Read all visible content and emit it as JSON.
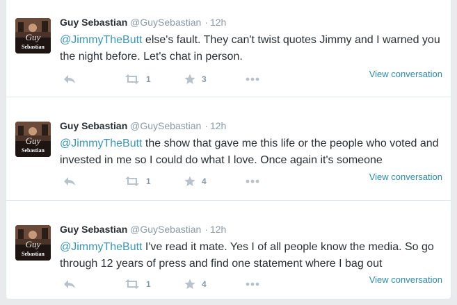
{
  "tweets": [
    {
      "fullname": "Guy Sebastian",
      "username": "@GuySebastian",
      "separator": "·",
      "time": "12h",
      "mention": "@JimmyTheButt",
      "text": " else's fault. They can't twist quotes Jimmy and I warned you the night before. Let's chat in person.",
      "retweets": "1",
      "favorites": "3",
      "view_conversation": "View conversation"
    },
    {
      "fullname": "Guy Sebastian",
      "username": "@GuySebastian",
      "separator": "·",
      "time": "12h",
      "mention": "@JimmyTheButt",
      "text": " the show that gave me this life or the people who voted and invested in me so I could do what I love. Once again it's someone",
      "retweets": "1",
      "favorites": "4",
      "view_conversation": "View conversation"
    },
    {
      "fullname": "Guy Sebastian",
      "username": "@GuySebastian",
      "separator": "·",
      "time": "12h",
      "mention": "@JimmyTheButt",
      "text": " I've read it mate. Yes I of all people know the media. So go through 12 years of press and find one statement where I bag out",
      "retweets": "1",
      "favorites": "4",
      "view_conversation": "View conversation"
    }
  ],
  "avatar_text": [
    "Guy",
    "Sebastian"
  ],
  "icons": {
    "reply": "reply-icon",
    "retweet": "retweet-icon",
    "favorite": "star-icon",
    "more": "more-icon"
  },
  "colors": {
    "link": "#3b94b0",
    "muted": "#8899a6",
    "text": "#292f33",
    "icon": "#b8c2cb"
  }
}
